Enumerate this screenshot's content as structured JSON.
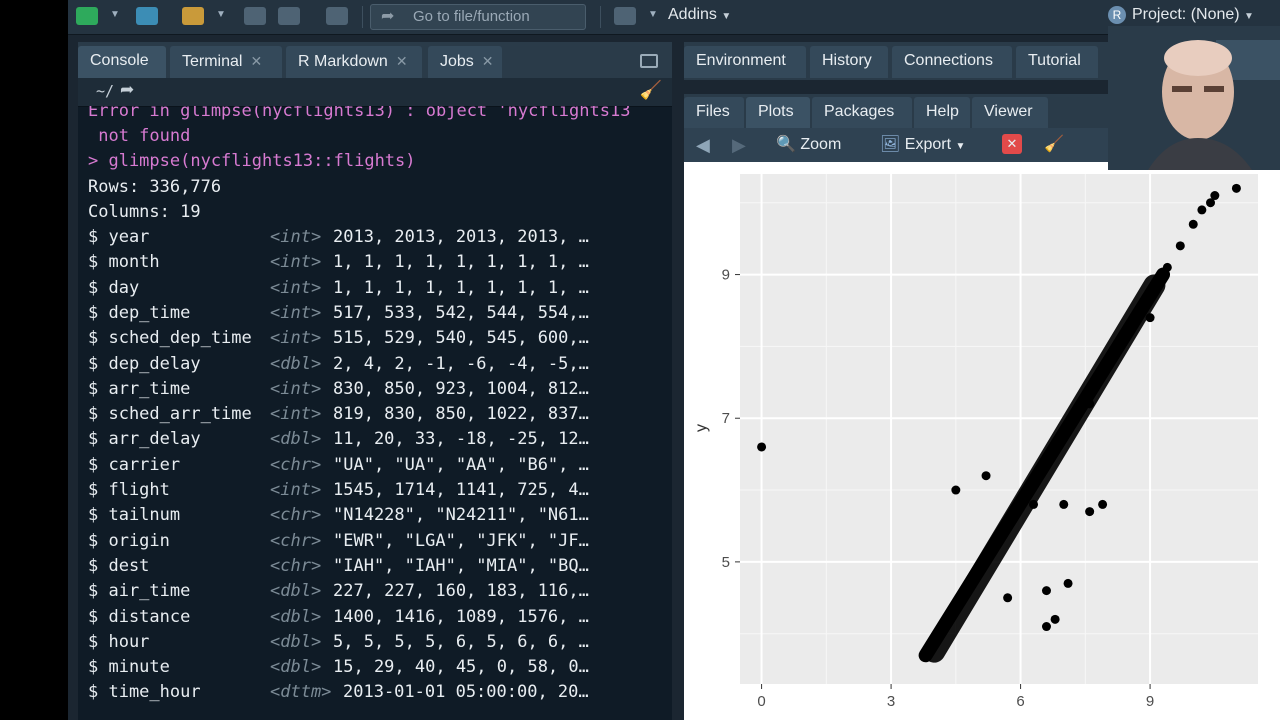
{
  "toolbar": {
    "goto_placeholder": "Go to file/function",
    "addins_label": "Addins",
    "project_label": "Project: (None)"
  },
  "console": {
    "tabs": [
      {
        "label": "Console"
      },
      {
        "label": "Terminal"
      },
      {
        "label": "R Markdown"
      },
      {
        "label": "Jobs"
      }
    ],
    "path": "~/",
    "error_line_1": "Error in glimpse(nycflights13) : object 'nycflights13",
    "error_line_2": " not found",
    "command": "> glimpse(nycflights13::flights)",
    "rows": "Rows: 336,776",
    "columns": "Columns: 19",
    "vars": [
      {
        "name": "$ year",
        "type": "<int>",
        "val": "2013, 2013, 2013, 2013, …"
      },
      {
        "name": "$ month",
        "type": "<int>",
        "val": "1, 1, 1, 1, 1, 1, 1, 1, …"
      },
      {
        "name": "$ day",
        "type": "<int>",
        "val": "1, 1, 1, 1, 1, 1, 1, 1, …"
      },
      {
        "name": "$ dep_time",
        "type": "<int>",
        "val": "517, 533, 542, 544, 554,…"
      },
      {
        "name": "$ sched_dep_time",
        "type": "<int>",
        "val": "515, 529, 540, 545, 600,…"
      },
      {
        "name": "$ dep_delay",
        "type": "<dbl>",
        "val": "2, 4, 2, -1, -6, -4, -5,…"
      },
      {
        "name": "$ arr_time",
        "type": "<int>",
        "val": "830, 850, 923, 1004, 812…"
      },
      {
        "name": "$ sched_arr_time",
        "type": "<int>",
        "val": "819, 830, 850, 1022, 837…"
      },
      {
        "name": "$ arr_delay",
        "type": "<dbl>",
        "val": "11, 20, 33, -18, -25, 12…"
      },
      {
        "name": "$ carrier",
        "type": "<chr>",
        "val": "\"UA\", \"UA\", \"AA\", \"B6\", …"
      },
      {
        "name": "$ flight",
        "type": "<int>",
        "val": "1545, 1714, 1141, 725, 4…"
      },
      {
        "name": "$ tailnum",
        "type": "<chr>",
        "val": "\"N14228\", \"N24211\", \"N61…"
      },
      {
        "name": "$ origin",
        "type": "<chr>",
        "val": "\"EWR\", \"LGA\", \"JFK\", \"JF…"
      },
      {
        "name": "$ dest",
        "type": "<chr>",
        "val": "\"IAH\", \"IAH\", \"MIA\", \"BQ…"
      },
      {
        "name": "$ air_time",
        "type": "<dbl>",
        "val": "227, 227, 160, 183, 116,…"
      },
      {
        "name": "$ distance",
        "type": "<dbl>",
        "val": "1400, 1416, 1089, 1576, …"
      },
      {
        "name": "$ hour",
        "type": "<dbl>",
        "val": "5, 5, 5, 5, 6, 5, 6, 6, …"
      },
      {
        "name": "$ minute",
        "type": "<dbl>",
        "val": "15, 29, 40, 45, 0, 58, 0…"
      },
      {
        "name": "$ time_hour",
        "type": "<dttm>",
        "val": "2013-01-01 05:00:00, 20…"
      }
    ]
  },
  "env_tabs": [
    {
      "label": "Environment"
    },
    {
      "label": "History"
    },
    {
      "label": "Connections"
    },
    {
      "label": "Tutorial"
    }
  ],
  "files_tabs": [
    {
      "label": "Files"
    },
    {
      "label": "Plots"
    },
    {
      "label": "Packages"
    },
    {
      "label": "Help"
    },
    {
      "label": "Viewer"
    }
  ],
  "plot_toolbar": {
    "zoom_label": "Zoom",
    "export_label": "Export"
  },
  "chart_data": {
    "type": "scatter",
    "ylabel": "y",
    "xlabel": "",
    "x_ticks": [
      "0",
      "3",
      "6",
      "9"
    ],
    "y_ticks": [
      "5",
      "7",
      "9"
    ],
    "xlim": [
      -0.5,
      11.5
    ],
    "ylim": [
      3.3,
      10.4
    ],
    "grid": true,
    "trend_band": {
      "x_start": 3.8,
      "y_start": 3.7,
      "x_end": 9.3,
      "y_end": 9.0
    },
    "points": [
      {
        "x": 0.0,
        "y": 6.6
      },
      {
        "x": 4.5,
        "y": 6.0
      },
      {
        "x": 5.2,
        "y": 6.2
      },
      {
        "x": 5.7,
        "y": 4.5
      },
      {
        "x": 6.6,
        "y": 4.6
      },
      {
        "x": 6.6,
        "y": 4.1
      },
      {
        "x": 6.8,
        "y": 4.2
      },
      {
        "x": 7.1,
        "y": 4.7
      },
      {
        "x": 7.0,
        "y": 5.8
      },
      {
        "x": 7.6,
        "y": 5.7
      },
      {
        "x": 6.3,
        "y": 5.8
      },
      {
        "x": 7.0,
        "y": 6.8
      },
      {
        "x": 7.6,
        "y": 7.2
      },
      {
        "x": 7.9,
        "y": 5.8
      },
      {
        "x": 9.0,
        "y": 8.4
      },
      {
        "x": 9.4,
        "y": 9.1
      },
      {
        "x": 9.7,
        "y": 9.4
      },
      {
        "x": 10.0,
        "y": 9.7
      },
      {
        "x": 10.2,
        "y": 9.9
      },
      {
        "x": 10.4,
        "y": 10.0
      },
      {
        "x": 10.5,
        "y": 10.1
      },
      {
        "x": 11.0,
        "y": 10.2
      }
    ]
  }
}
